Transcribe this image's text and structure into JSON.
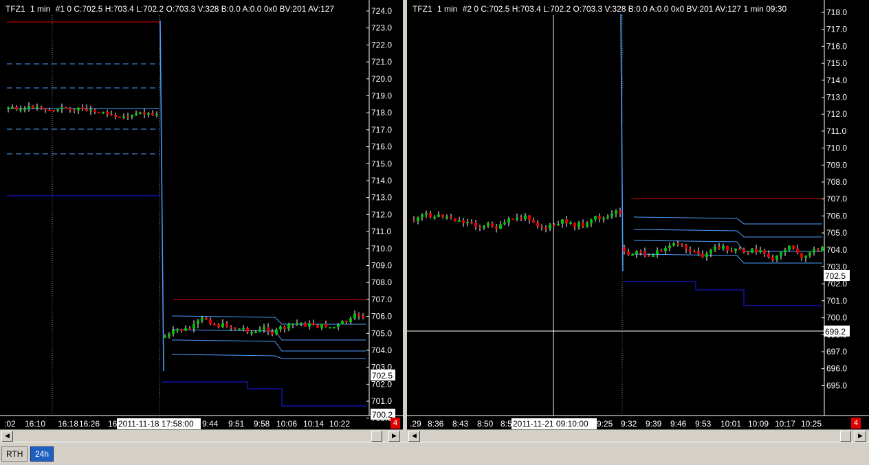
{
  "pane1": {
    "symbol": "TFZ1",
    "interval": "1 min",
    "header_rest": "#1 0 C:702.5 H:703.4 L:702.2 O:703.3 V:328 B:0.0 A:0.0 0x0 BV:201 AV:127",
    "price_labels": [
      "724.0",
      "723.0",
      "722.0",
      "721.0",
      "720.0",
      "719.0",
      "718.0",
      "717.0",
      "716.0",
      "715.0",
      "714.0",
      "713.0",
      "712.0",
      "711.0",
      "710.0",
      "709.0",
      "708.0",
      "707.0",
      "706.0",
      "705.0",
      "704.0",
      "703.0",
      "702.0",
      "701.0",
      "700.0"
    ],
    "current_price": "702.5",
    "cursor_price": "700.2",
    "time_labels": [
      ":02",
      "16:10",
      "16:18",
      "16:26",
      "16",
      "9:44",
      "9:51",
      "9:58",
      "10:06",
      "10:14",
      "10:22"
    ],
    "cursor_time": "2011-11-18 17:58:00",
    "badge": "4"
  },
  "pane2": {
    "symbol": "TFZ1",
    "interval": "1 min",
    "header_rest": "#2 0 C:702.5 H:703.4 L:702.2 O:703.3 V:328 B:0.0 A:0.0 0x0 BV:201 AV:127 1 min 09:30",
    "price_labels": [
      "718.0",
      "717.0",
      "716.0",
      "715.0",
      "714.0",
      "713.0",
      "712.0",
      "711.0",
      "710.0",
      "709.0",
      "708.0",
      "707.0",
      "706.0",
      "705.0",
      "704.0",
      "703.0",
      "702.0",
      "701.0",
      "700.0",
      "698.0",
      "697.0",
      "696.0",
      "695.0"
    ],
    "current_price": "702.5",
    "cursor_price": "699.2",
    "time_labels": [
      ".29",
      "8:36",
      "8:43",
      "8:50",
      "8:5",
      "9:25",
      "9:32",
      "9:39",
      "9:46",
      "9:53",
      "10:01",
      "10:09",
      "10:17",
      "10:25"
    ],
    "cursor_time": "2011-11-21 09:10:00",
    "badge": "4"
  },
  "tabs": [
    {
      "label": "RTH",
      "active": false
    },
    {
      "label": "24h",
      "active": true
    }
  ],
  "colors": {
    "bull": "#00c000",
    "bear": "#e00000",
    "blue": "#1a1aff",
    "lightblue": "#4aa0ff",
    "red_line": "#e00000"
  },
  "icons": {
    "left": "scroll-left-arrow-icon",
    "right": "scroll-right-arrow-icon"
  }
}
